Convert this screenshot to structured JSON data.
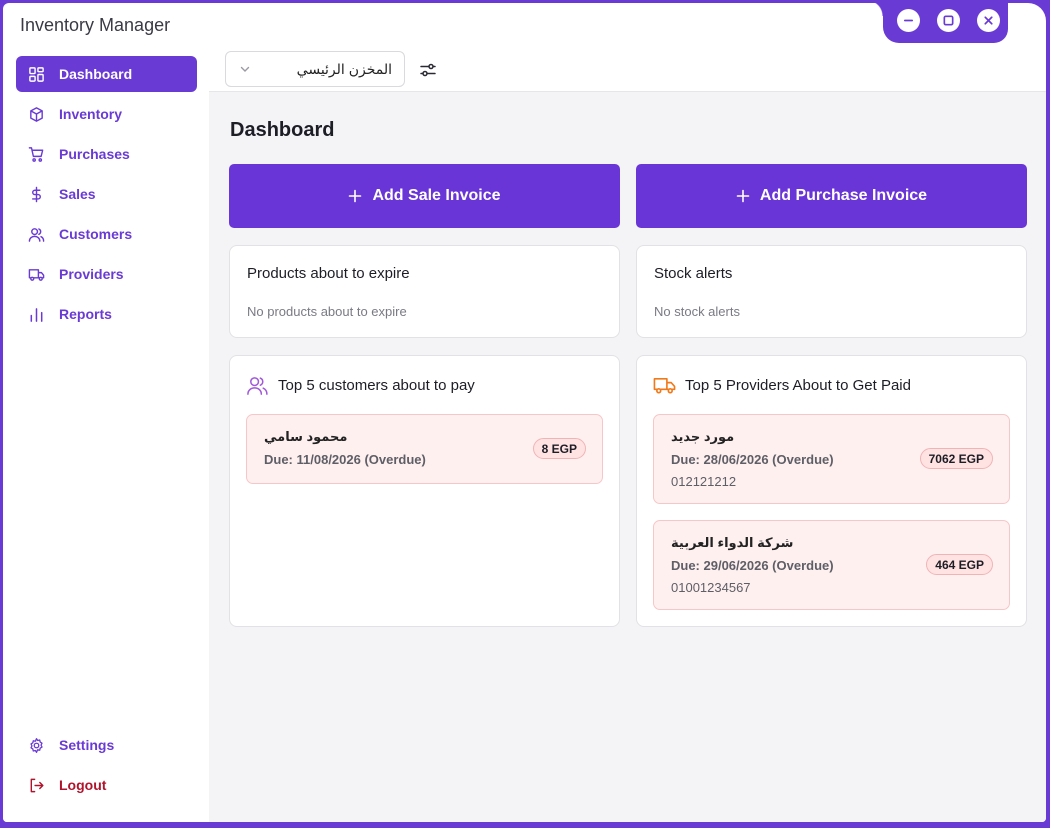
{
  "app": {
    "title": "Inventory Manager"
  },
  "sidebar": {
    "items": [
      {
        "label": "Dashboard",
        "icon": "grid-icon",
        "active": true
      },
      {
        "label": "Inventory",
        "icon": "box-icon"
      },
      {
        "label": "Purchases",
        "icon": "cart-icon"
      },
      {
        "label": "Sales",
        "icon": "dollar-icon"
      },
      {
        "label": "Customers",
        "icon": "users-icon"
      },
      {
        "label": "Providers",
        "icon": "truck-icon"
      },
      {
        "label": "Reports",
        "icon": "bar-chart-icon"
      }
    ],
    "settings_label": "Settings",
    "logout_label": "Logout"
  },
  "topbar": {
    "warehouse_selected": "المخزن الرئيسي"
  },
  "main": {
    "title": "Dashboard",
    "add_sale_label": "Add Sale Invoice",
    "add_purchase_label": "Add Purchase Invoice",
    "expire_card": {
      "title": "Products about to expire",
      "empty": "No products about to expire"
    },
    "stock_card": {
      "title": "Stock alerts",
      "empty": "No stock alerts"
    },
    "customers_card": {
      "title": "Top 5 customers about to pay",
      "items": [
        {
          "name": "محمود سامي",
          "due": "Due: 11/08/2026 (Overdue)",
          "amount": "8 EGP"
        }
      ]
    },
    "providers_card": {
      "title": "Top 5 Providers About to Get Paid",
      "items": [
        {
          "name": "مورد جديد",
          "due": "Due: 28/06/2026 (Overdue)",
          "phone": "012121212",
          "amount": "7062 EGP"
        },
        {
          "name": "شركة الدواء العربية",
          "due": "Due: 29/06/2026 (Overdue)",
          "phone": "01001234567",
          "amount": "464 EGP"
        }
      ]
    }
  },
  "colors": {
    "accent": "#6a3bd4",
    "danger": "#b0142c",
    "overdue_bg": "#fff0f0",
    "provider_icon": "#f07a1a",
    "customer_icon": "#a05ad8"
  }
}
